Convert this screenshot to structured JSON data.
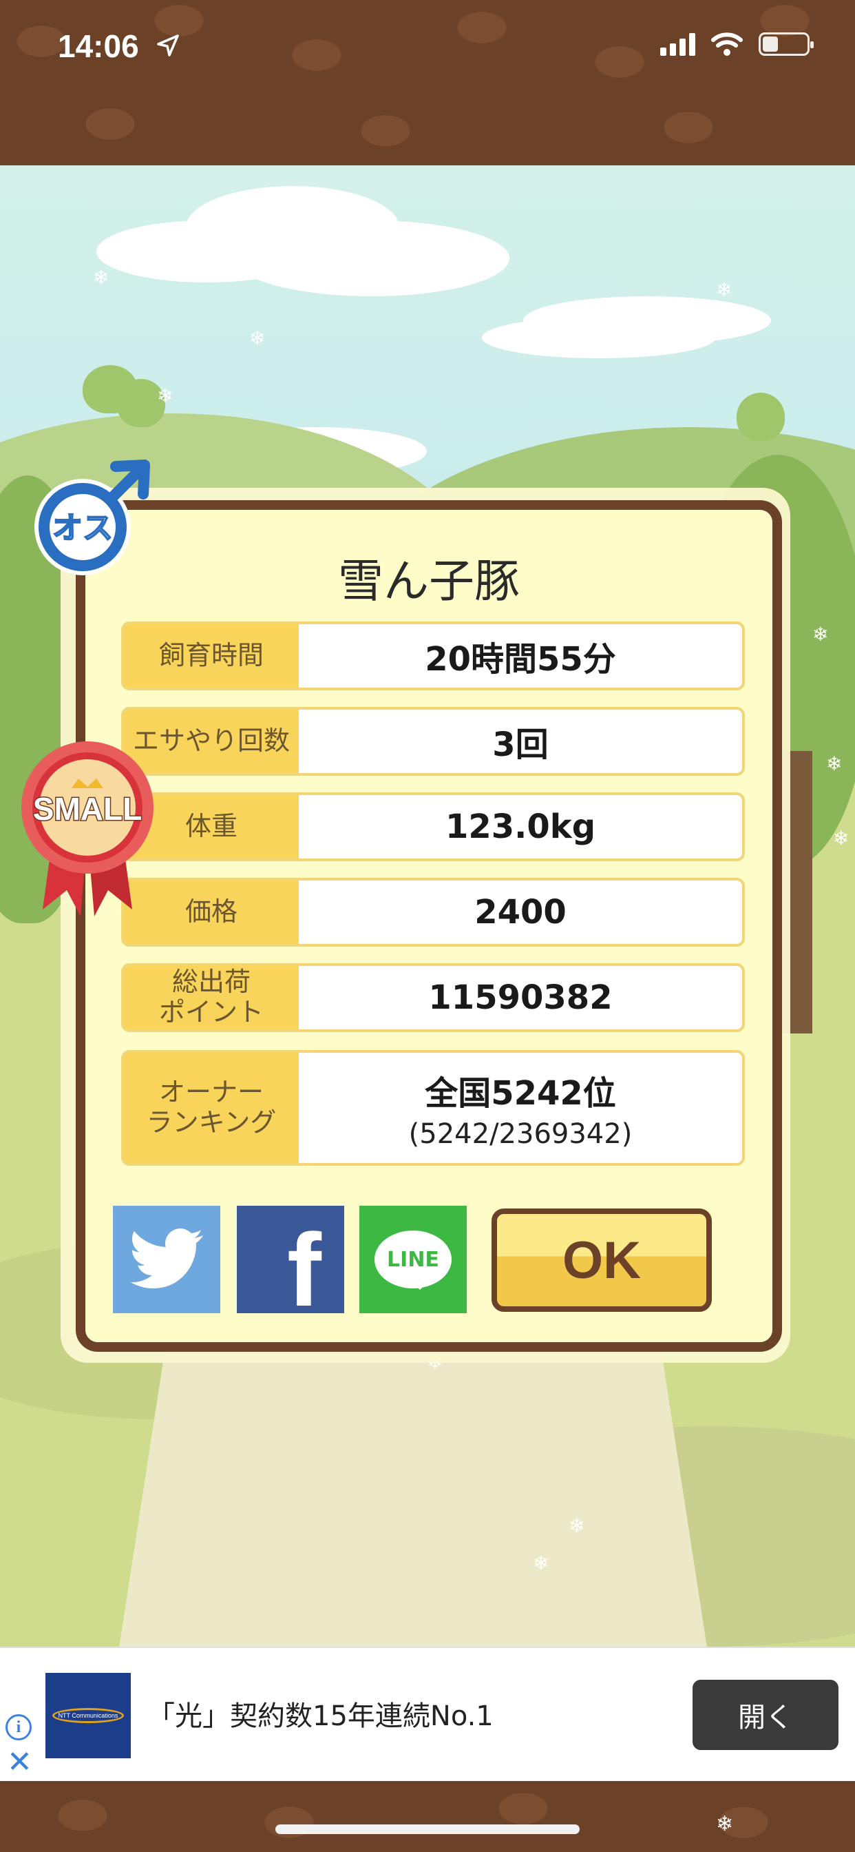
{
  "status_bar": {
    "time": "14:06"
  },
  "dialog": {
    "title": "雪ん子豚",
    "rows": [
      {
        "label": "飼育時間",
        "value": "20時間55分"
      },
      {
        "label": "エサやり回数",
        "value": "3回"
      },
      {
        "label": "体重",
        "value": "123.0kg"
      },
      {
        "label": "価格",
        "value": "2400"
      },
      {
        "label": "総出荷\nポイント",
        "value": "11590382"
      },
      {
        "label": "オーナー\nランキング",
        "value": "全国5242位",
        "sub": "(5242/2369342)"
      }
    ],
    "ok_label": "OK",
    "line_label": "LINE",
    "fb_label": "f"
  },
  "badges": {
    "gender": "オス",
    "size": "SMALL"
  },
  "ad": {
    "text": "「光」契約数15年連続No.1",
    "open_label": "開く",
    "logo_text": "NTT Communications",
    "info_label": "i",
    "close_label": "✕"
  },
  "colors": {
    "brown": "#6b4128",
    "label_yellow": "#f8d45a",
    "twitter": "#6ea8df",
    "facebook": "#3b5998",
    "line": "#3cb843"
  },
  "icons": [
    "location-arrow-icon",
    "cellular-signal-icon",
    "wifi-icon",
    "battery-icon",
    "male-symbol-icon",
    "twitter-bird-icon",
    "facebook-icon",
    "line-icon",
    "ribbon-icon",
    "ad-info-icon",
    "ad-close-icon"
  ]
}
